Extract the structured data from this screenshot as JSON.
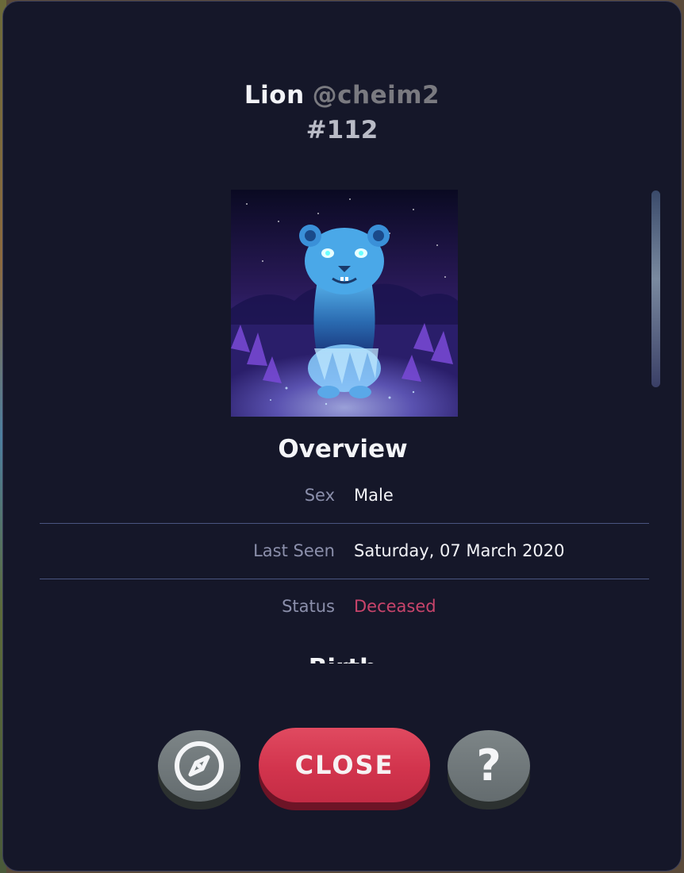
{
  "header": {
    "name": "Lion",
    "handle": "@cheim2",
    "number": "#112"
  },
  "overview": {
    "title": "Overview",
    "rows": [
      {
        "label": "Sex",
        "value": "Male"
      },
      {
        "label": "Last Seen",
        "value": "Saturday, 07 March 2020"
      },
      {
        "label": "Status",
        "value": "Deceased"
      }
    ]
  },
  "next_section_title": "Birth",
  "footer": {
    "close_label": "CLOSE",
    "left_icon": "compass-icon",
    "right_icon": "question-icon"
  },
  "colors": {
    "background": "#151729",
    "status_deceased": "#c9446b",
    "close_button": "#d2344d",
    "gray_button": "#6a7275"
  }
}
